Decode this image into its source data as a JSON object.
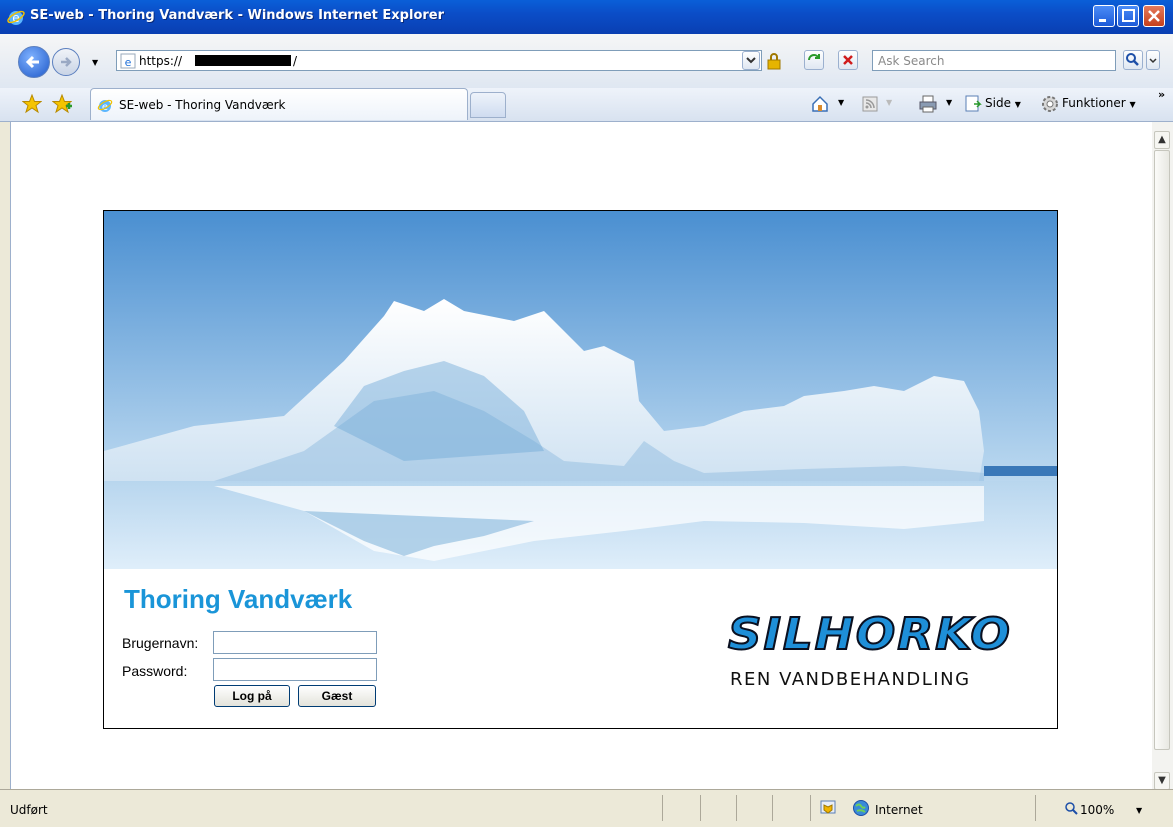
{
  "window": {
    "title": "SE-web - Thoring Vandværk - Windows Internet Explorer"
  },
  "address": {
    "url": "https://"
  },
  "search": {
    "placeholder": "Ask Search"
  },
  "tab": {
    "label": "SE-web - Thoring Vandværk"
  },
  "commandbar": {
    "side": "Side",
    "tools": "Funktioner",
    "overflow": "»"
  },
  "page": {
    "site_title": "Thoring Vandværk",
    "username_label": "Brugernavn:",
    "password_label": "Password:",
    "username_value": "",
    "password_value": "",
    "login_button": "Log på",
    "guest_button": "Gæst",
    "brand_name": "SILHORKO",
    "brand_tagline": "REN VANDBEHANDLING"
  },
  "status": {
    "text": "Udført",
    "zone": "Internet",
    "zoom": "100%"
  },
  "colors": {
    "title_blue": "#1a95d8",
    "brand_blue": "#1e8fd8"
  }
}
